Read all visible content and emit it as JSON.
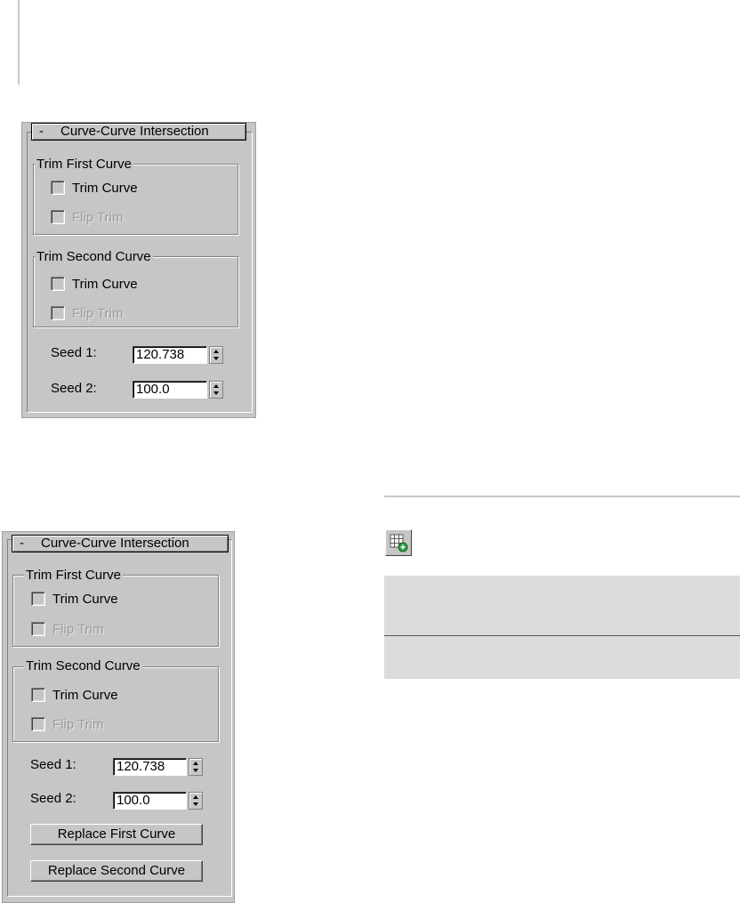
{
  "rollout_a": {
    "title": "Curve-Curve Intersection",
    "collapse_symbol": "-",
    "group1": {
      "label": "Trim First Curve",
      "trim_curve": "Trim Curve",
      "flip_trim": "Flip Trim"
    },
    "group2": {
      "label": "Trim Second Curve",
      "trim_curve": "Trim Curve",
      "flip_trim": "Flip Trim"
    },
    "seed1": {
      "label": "Seed 1:",
      "value": "120.738"
    },
    "seed2": {
      "label": "Seed 2:",
      "value": "100.0"
    }
  },
  "rollout_b": {
    "title": "Curve-Curve Intersection",
    "collapse_symbol": "-",
    "group1": {
      "label": "Trim First Curve",
      "trim_curve": "Trim Curve",
      "flip_trim": "Flip Trim"
    },
    "group2": {
      "label": "Trim Second Curve",
      "trim_curve": "Trim Curve",
      "flip_trim": "Flip Trim"
    },
    "seed1": {
      "label": "Seed 1:",
      "value": "120.738"
    },
    "seed2": {
      "label": "Seed 2:",
      "value": "100.0"
    },
    "replace_first": "Replace First Curve",
    "replace_second": "Replace Second Curve"
  },
  "toolbar": {
    "icon": "create-curve-curve-intersection-icon"
  },
  "colors": {
    "panel_bg": "#c6c6c6",
    "table_bg": "#dcdcdc",
    "disabled_text": "#9a9a9a"
  }
}
